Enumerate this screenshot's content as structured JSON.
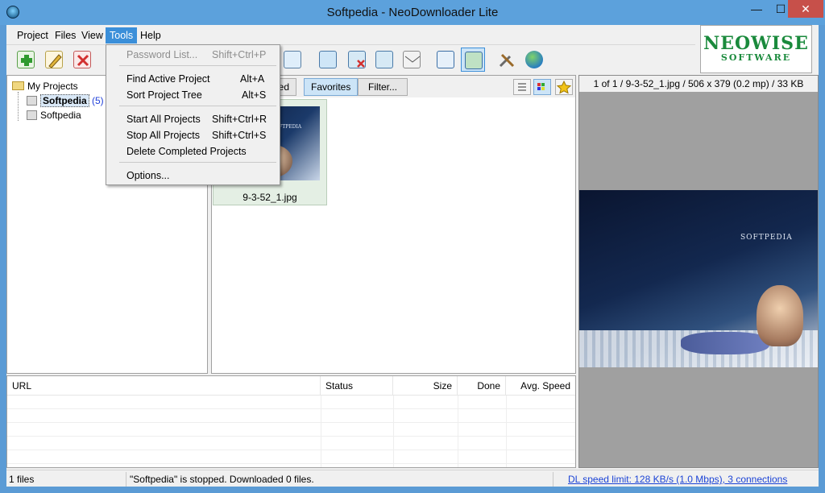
{
  "window": {
    "title": "Softpedia - NeoDownloader Lite",
    "min_glyph": "—",
    "max_glyph": "☐",
    "close_glyph": "✕"
  },
  "menu": [
    "Project",
    "Files",
    "View",
    "Tools",
    "Help"
  ],
  "logo": {
    "line1": "NEOWISE",
    "line2": "SOFTWARE"
  },
  "toolbar": {
    "icons": [
      "add-project-icon",
      "edit-project-icon",
      "delete-project-icon",
      "picture-frame-icon",
      "import-image-icon",
      "remove-image-icon",
      "image-view-icon",
      "email-icon",
      "open-window-icon",
      "fullscreen-image-icon",
      "tools-icon",
      "web-globe-icon"
    ]
  },
  "tree": {
    "root": "My Projects",
    "nodes": [
      {
        "label": "Softpedia",
        "count": "(5)",
        "selected": true
      },
      {
        "label": "Softpedia",
        "count": "",
        "selected": false
      }
    ]
  },
  "thumbs": {
    "tab_partial": "wed",
    "tab_favorites": "Favorites",
    "filter": "Filter...",
    "card_title": "SOFTPEDIA",
    "caption": "9-3-52_1.jpg"
  },
  "preview": {
    "header": "1 of 1 / 9-3-52_1.jpg / 506 x 379 (0.2 mp) / 33 KB",
    "image_title": "SOFTPEDIA"
  },
  "downloads": {
    "columns": [
      "URL",
      "Status",
      "Size",
      "Done",
      "Avg. Speed"
    ]
  },
  "status": {
    "files": "1 files",
    "message": "\"Softpedia\" is stopped. Downloaded 0 files.",
    "speed_link": "DL speed limit: 128 KB/s (1.0 Mbps), 3 connections"
  },
  "tools_menu": [
    {
      "label": "Password List...",
      "shortcut": "Shift+Ctrl+P",
      "disabled": true
    },
    {
      "label": "Find Active Project",
      "shortcut": "Alt+A"
    },
    {
      "label": "Sort Project Tree",
      "shortcut": "Alt+S"
    },
    {
      "label": "Start All Projects",
      "shortcut": "Shift+Ctrl+R"
    },
    {
      "label": "Stop All Projects",
      "shortcut": "Shift+Ctrl+S"
    },
    {
      "label": "Delete Completed Projects",
      "shortcut": ""
    },
    {
      "label": "Options...",
      "shortcut": ""
    }
  ],
  "colors": {
    "titlebar": "#5ca1dc",
    "menu_highlight": "#3b8fd9",
    "close_button": "#c7504a",
    "logo_green": "#1a8a3c",
    "link_blue": "#1c44d6"
  }
}
